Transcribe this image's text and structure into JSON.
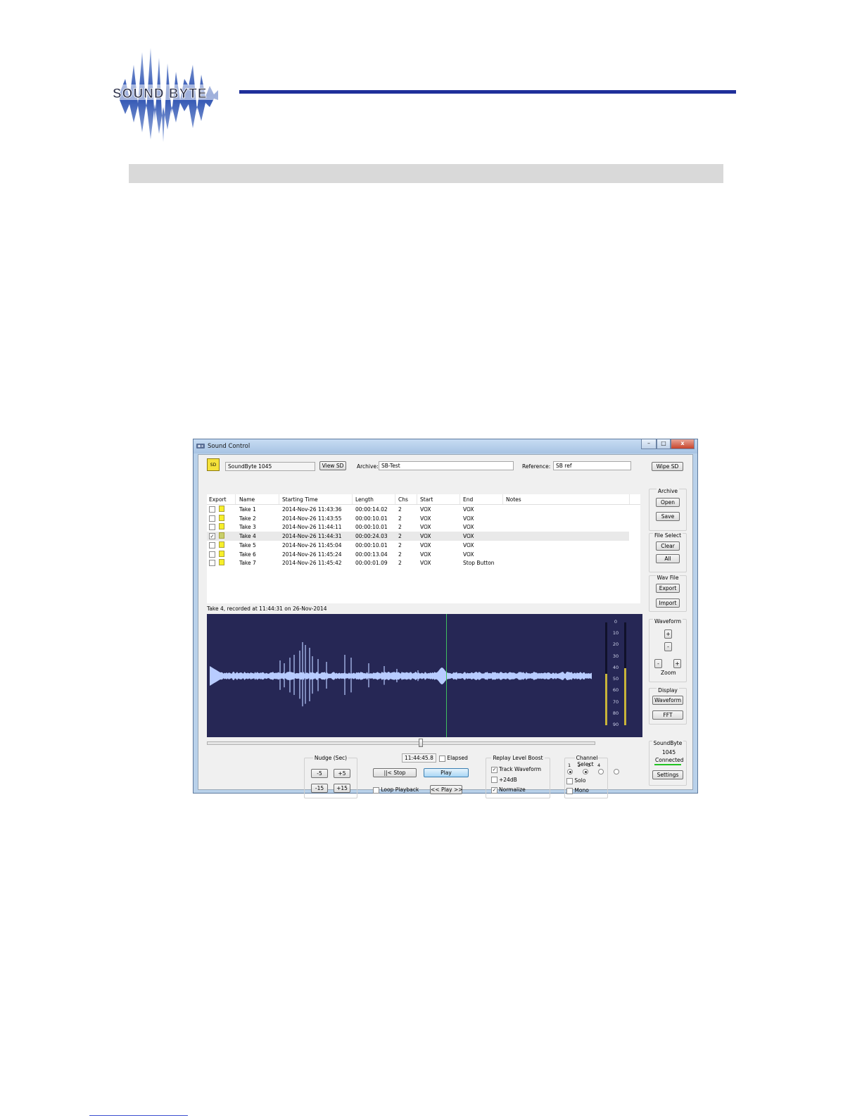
{
  "page": {
    "logo_text": "SOUND BYTE"
  },
  "window": {
    "title": "Sound Control",
    "controls": {
      "minimize": "–",
      "maximize": "□",
      "close": "x"
    }
  },
  "toolbar": {
    "sd_icon_label": "SD",
    "device_name": "SoundByte 1045",
    "view_sd_label": "View SD",
    "archive_label": "Archive:",
    "archive_value": "SB-Test",
    "reference_label": "Reference:",
    "reference_value": "SB ref",
    "wipe_sd_label": "Wipe SD"
  },
  "table": {
    "columns": [
      "Export",
      "Name",
      "Starting Time",
      "Length",
      "Chs",
      "Start",
      "End",
      "Notes"
    ],
    "rows": [
      {
        "name": "Take 1",
        "start_time": "2014-Nov-26 11:43:36",
        "length": "00:00:14.02",
        "chs": "2",
        "start": "VOX",
        "end": "VOX",
        "notes": "",
        "checked": false,
        "selected": false
      },
      {
        "name": "Take 2",
        "start_time": "2014-Nov-26 11:43:55",
        "length": "00:00:10.01",
        "chs": "2",
        "start": "VOX",
        "end": "VOX",
        "notes": "",
        "checked": false,
        "selected": false
      },
      {
        "name": "Take 3",
        "start_time": "2014-Nov-26 11:44:11",
        "length": "00:00:10.01",
        "chs": "2",
        "start": "VOX",
        "end": "VOX",
        "notes": "",
        "checked": false,
        "selected": false
      },
      {
        "name": "Take 4",
        "start_time": "2014-Nov-26 11:44:31",
        "length": "00:00:24.03",
        "chs": "2",
        "start": "VOX",
        "end": "VOX",
        "notes": "",
        "checked": true,
        "selected": true
      },
      {
        "name": "Take 5",
        "start_time": "2014-Nov-26 11:45:04",
        "length": "00:00:10.01",
        "chs": "2",
        "start": "VOX",
        "end": "VOX",
        "notes": "",
        "checked": false,
        "selected": false
      },
      {
        "name": "Take 6",
        "start_time": "2014-Nov-26 11:45:24",
        "length": "00:00:13.04",
        "chs": "2",
        "start": "VOX",
        "end": "VOX",
        "notes": "",
        "checked": false,
        "selected": false
      },
      {
        "name": "Take 7",
        "start_time": "2014-Nov-26 11:45:42",
        "length": "00:00:01.09",
        "chs": "2",
        "start": "VOX",
        "end": "Stop Button",
        "notes": "",
        "checked": false,
        "selected": false
      }
    ]
  },
  "status_line": "Take 4, recorded at 11:44:31 on 26-Nov-2014",
  "meter": {
    "ticks": [
      "0",
      "10",
      "20",
      "30",
      "40",
      "50",
      "60",
      "70",
      "80",
      "90"
    ],
    "left_level_db": 45,
    "right_level_db": 40
  },
  "playback": {
    "position_fraction": 0.55,
    "time_readout": "11:44:45.8",
    "elapsed_label": "Elapsed",
    "stop_label": "||< Stop",
    "play_label": "Play",
    "loop_label": "Loop Playback",
    "play_nudge_label": "<< Play >>"
  },
  "nudge": {
    "title": "Nudge (Sec)",
    "buttons": [
      "-5",
      "+5",
      "-15",
      "+15"
    ]
  },
  "replay_boost": {
    "title": "Replay Level Boost",
    "options": [
      {
        "label": "Track Waveform",
        "checked": true
      },
      {
        "label": "+24dB",
        "checked": false
      },
      {
        "label": "Normalize",
        "checked": true
      }
    ]
  },
  "channel_select": {
    "title": "Channel Select",
    "channels": [
      "1",
      "2",
      "3",
      "4"
    ],
    "active": [
      true,
      true,
      false,
      false
    ],
    "solo_label": "Solo",
    "mono_label": "Mono"
  },
  "sidebar": {
    "archive": {
      "title": "Archive",
      "open": "Open",
      "save": "Save"
    },
    "file_select": {
      "title": "File Select",
      "clear": "Clear",
      "all": "All"
    },
    "wav_file": {
      "title": "Wav File",
      "export": "Export",
      "import": "Import"
    },
    "waveform": {
      "title": "Waveform",
      "plus": "+",
      "minus": "-",
      "zoom_minus": "-",
      "zoom_plus": "+",
      "zoom_label": "Zoom"
    },
    "display": {
      "title": "Display",
      "waveform": "Waveform",
      "fft": "FFT"
    },
    "device": {
      "title": "SoundByte",
      "number": "1045",
      "status": "Connected",
      "settings": "Settings",
      "status_color": "#22c322"
    }
  },
  "colors": {
    "wave_bg": "#262755",
    "wave_fg": "#b8ccff",
    "playhead": "#3fbf5f",
    "meter_level": "#c8b43a",
    "accent_line": "#1f2f9a"
  }
}
